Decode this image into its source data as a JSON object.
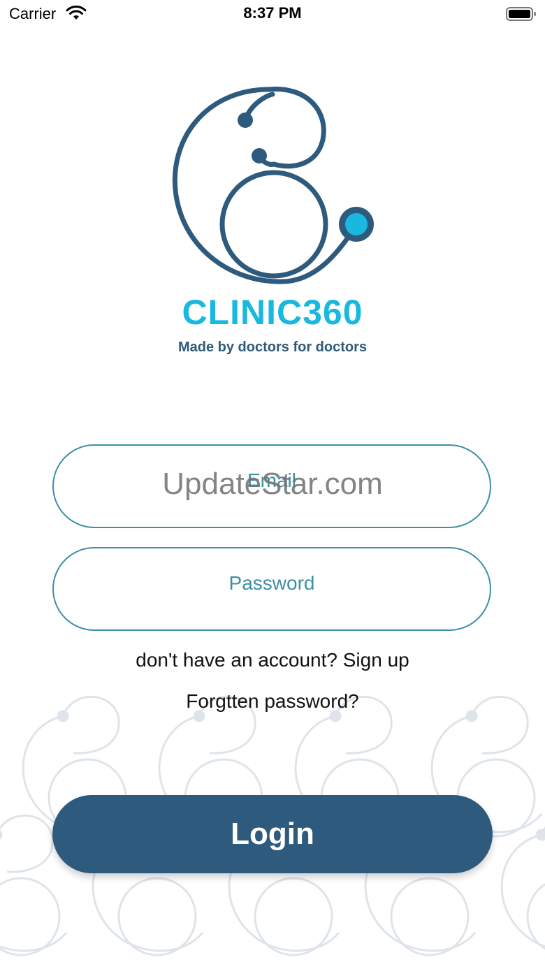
{
  "status_bar": {
    "carrier": "Carrier",
    "time": "8:37 PM",
    "wifi_icon": "wifi-icon",
    "battery_icon": "battery-full-icon"
  },
  "branding": {
    "logo_icon": "stethoscope-logo-icon",
    "name": "CLINIC360",
    "tagline": "Made by doctors for doctors",
    "colors": {
      "primary": "#2e5b7d",
      "accent": "#19b8df",
      "field_border": "#3d8fa4"
    }
  },
  "form": {
    "email_placeholder": "Email",
    "password_placeholder": "Password",
    "signup_text": "don't have an account? Sign up",
    "forgot_text": "Forgtten password?",
    "login_label": "Login"
  },
  "watermark": "UpdateStar.com"
}
